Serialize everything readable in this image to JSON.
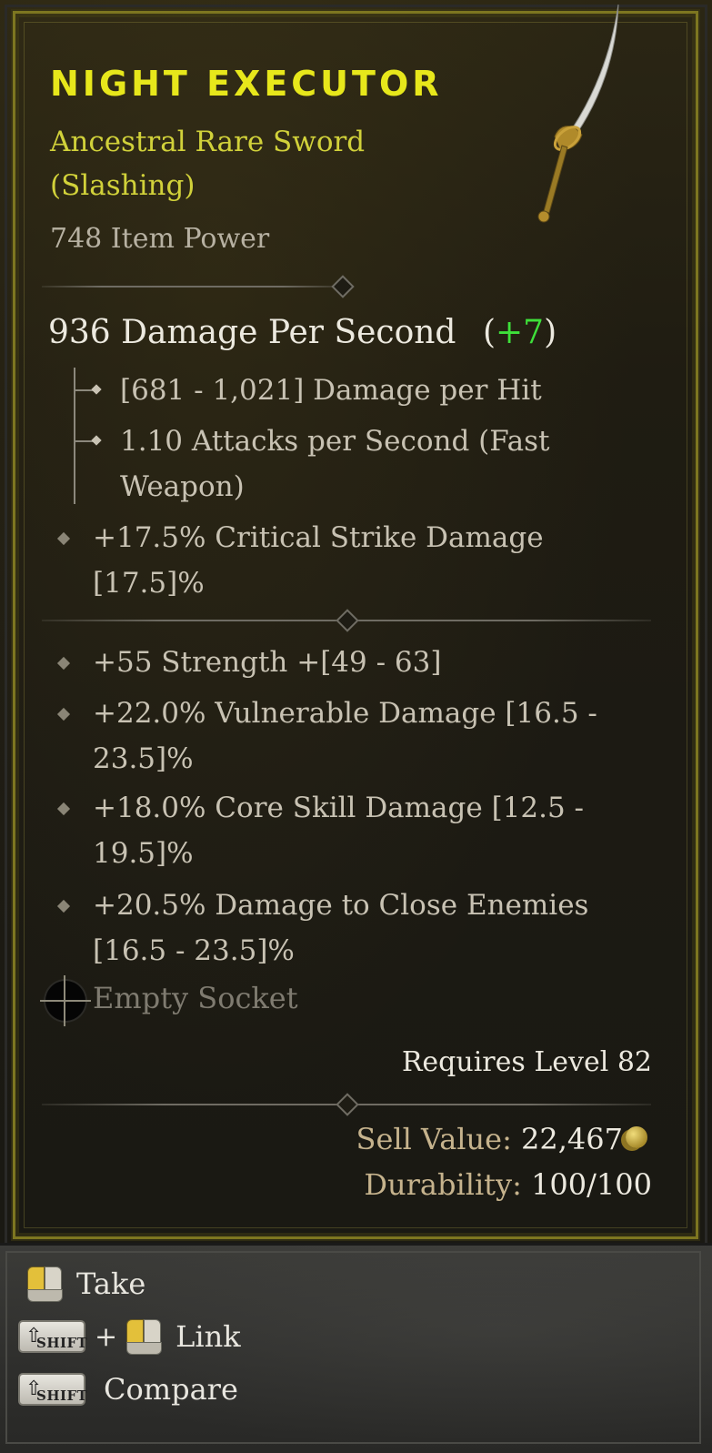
{
  "item": {
    "name": "NIGHT EXECUTOR",
    "type_line1": "Ancestral Rare Sword",
    "type_line2": "(Slashing)",
    "item_power": "748 Item Power",
    "dps_label": "936 Damage Per Second",
    "dps_delta": "+7",
    "damage_per_hit": "[681 - 1,021] Damage per Hit",
    "attacks_line1": "1.10 Attacks per Second (Fast",
    "attacks_line2": "Weapon)",
    "implicit": "+17.5% Critical Strike Damage [17.5]%",
    "affixes": [
      "+55 Strength +[49 - 63]",
      "+22.0% Vulnerable Damage [16.5 - 23.5]%",
      "+18.0% Core Skill Damage [12.5 - 19.5]%",
      "+20.5% Damage to Close Enemies [16.5 - 23.5]%"
    ],
    "socket": "Empty Socket",
    "requires_level": "Requires Level 82",
    "sell_label": "Sell Value:",
    "sell_value": "22,467",
    "durability_label": "Durability:",
    "durability_value": "100/100"
  },
  "controls": {
    "take": "Take",
    "plus": "+",
    "link": "Link",
    "compare": "Compare",
    "shift_key": "SHIFT"
  },
  "colors": {
    "title": "#e7e71b",
    "rare": "#d1d13a",
    "positive_delta": "#3ee03a",
    "affix_text": "#c8c2b3"
  },
  "icons": [
    "sword-icon",
    "socket-icon",
    "gold-coin-icon",
    "mouse-left-click-icon",
    "shift-key-icon"
  ]
}
